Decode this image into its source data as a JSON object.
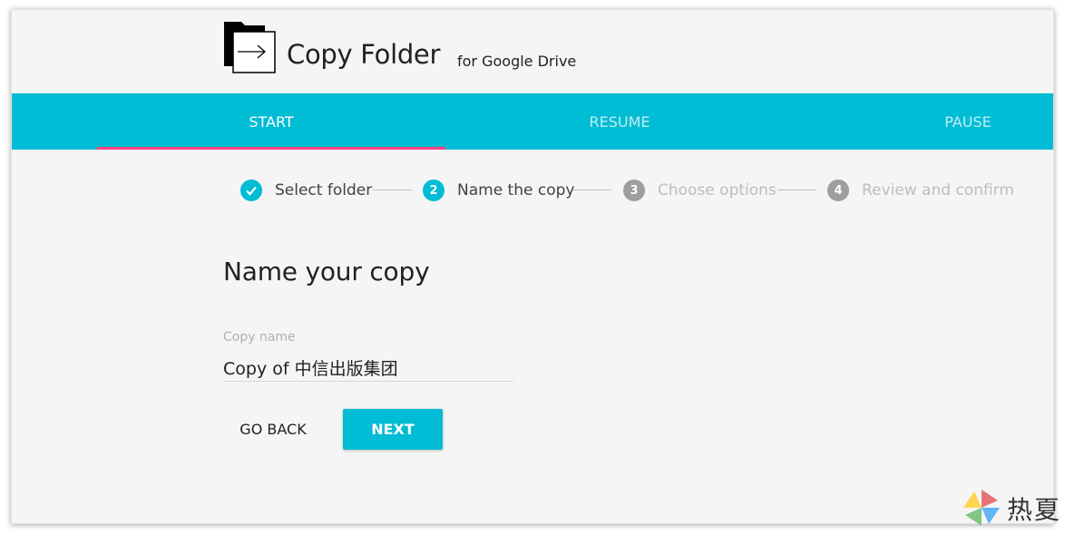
{
  "header": {
    "title": "Copy Folder",
    "subtitle": "for Google Drive",
    "logo_icon": "folder-copy-icon"
  },
  "tabs": [
    {
      "label": "START",
      "active": true
    },
    {
      "label": "RESUME",
      "active": false
    },
    {
      "label": "PAUSE",
      "active": false
    }
  ],
  "stepper": {
    "steps": [
      {
        "label": "Select folder",
        "status": "done",
        "icon": "check-icon"
      },
      {
        "label": "Name the copy",
        "status": "current",
        "number": "2"
      },
      {
        "label": "Choose options",
        "status": "pending",
        "number": "3"
      },
      {
        "label": "Review and confirm",
        "status": "pending",
        "number": "4"
      }
    ]
  },
  "main": {
    "heading": "Name your copy",
    "field_label": "Copy name",
    "field_value": "Copy of 中信出版集团",
    "back_label": "GO BACK",
    "next_label": "NEXT"
  },
  "watermark": {
    "text": "热夏",
    "icon": "pinwheel-icon"
  },
  "colors": {
    "accent": "#00bcd4",
    "indicator": "#ff4081",
    "background": "#f5f5f5",
    "pending_step": "#9e9e9e"
  }
}
